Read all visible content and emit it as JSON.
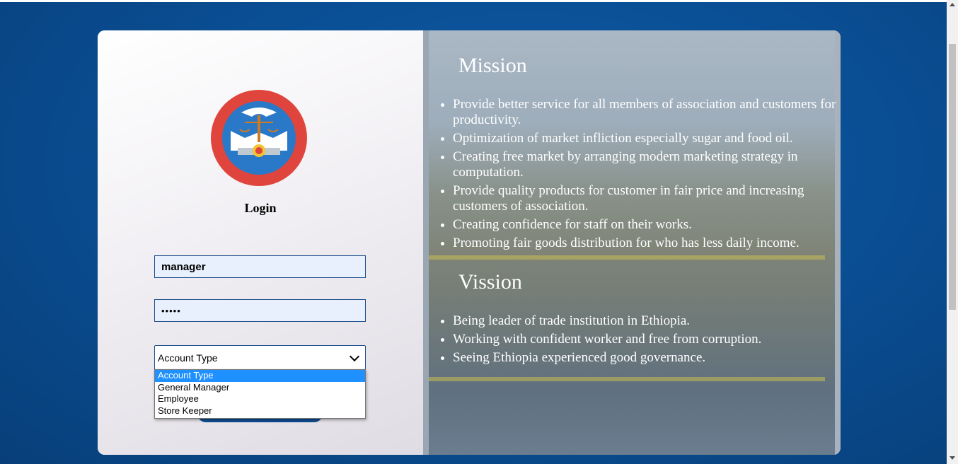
{
  "login": {
    "title": "Login",
    "username_value": "manager",
    "password_value": "•••••",
    "account_type": {
      "selected": "Account Type",
      "options": [
        "Account Type",
        "General Manager",
        "Employee",
        "Store Keeper"
      ]
    }
  },
  "mission": {
    "title": "Mission",
    "items": [
      "Provide better service for all members of association and customers for productivity.",
      "Optimization of market infliction especially sugar and food oil.",
      "Creating free market by arranging modern marketing strategy in computation.",
      "Provide quality products for customer in fair price and increasing customers of association.",
      "Creating confidence for staff on their works.",
      "Promoting fair goods distribution for who has less daily income."
    ]
  },
  "vision": {
    "title": "Vission",
    "items": [
      "Being leader of trade institution in Ethiopia.",
      "Working with confident worker and free from corruption.",
      "Seeing Ethiopia experienced good governance."
    ]
  },
  "colors": {
    "background": "#0a4f95",
    "accent": "#0e4d93",
    "selected_option": "#1e90ff"
  },
  "icons": {
    "logo": "addis-ababa-city-administration-seal",
    "select_arrow": "chevron-down-icon"
  }
}
